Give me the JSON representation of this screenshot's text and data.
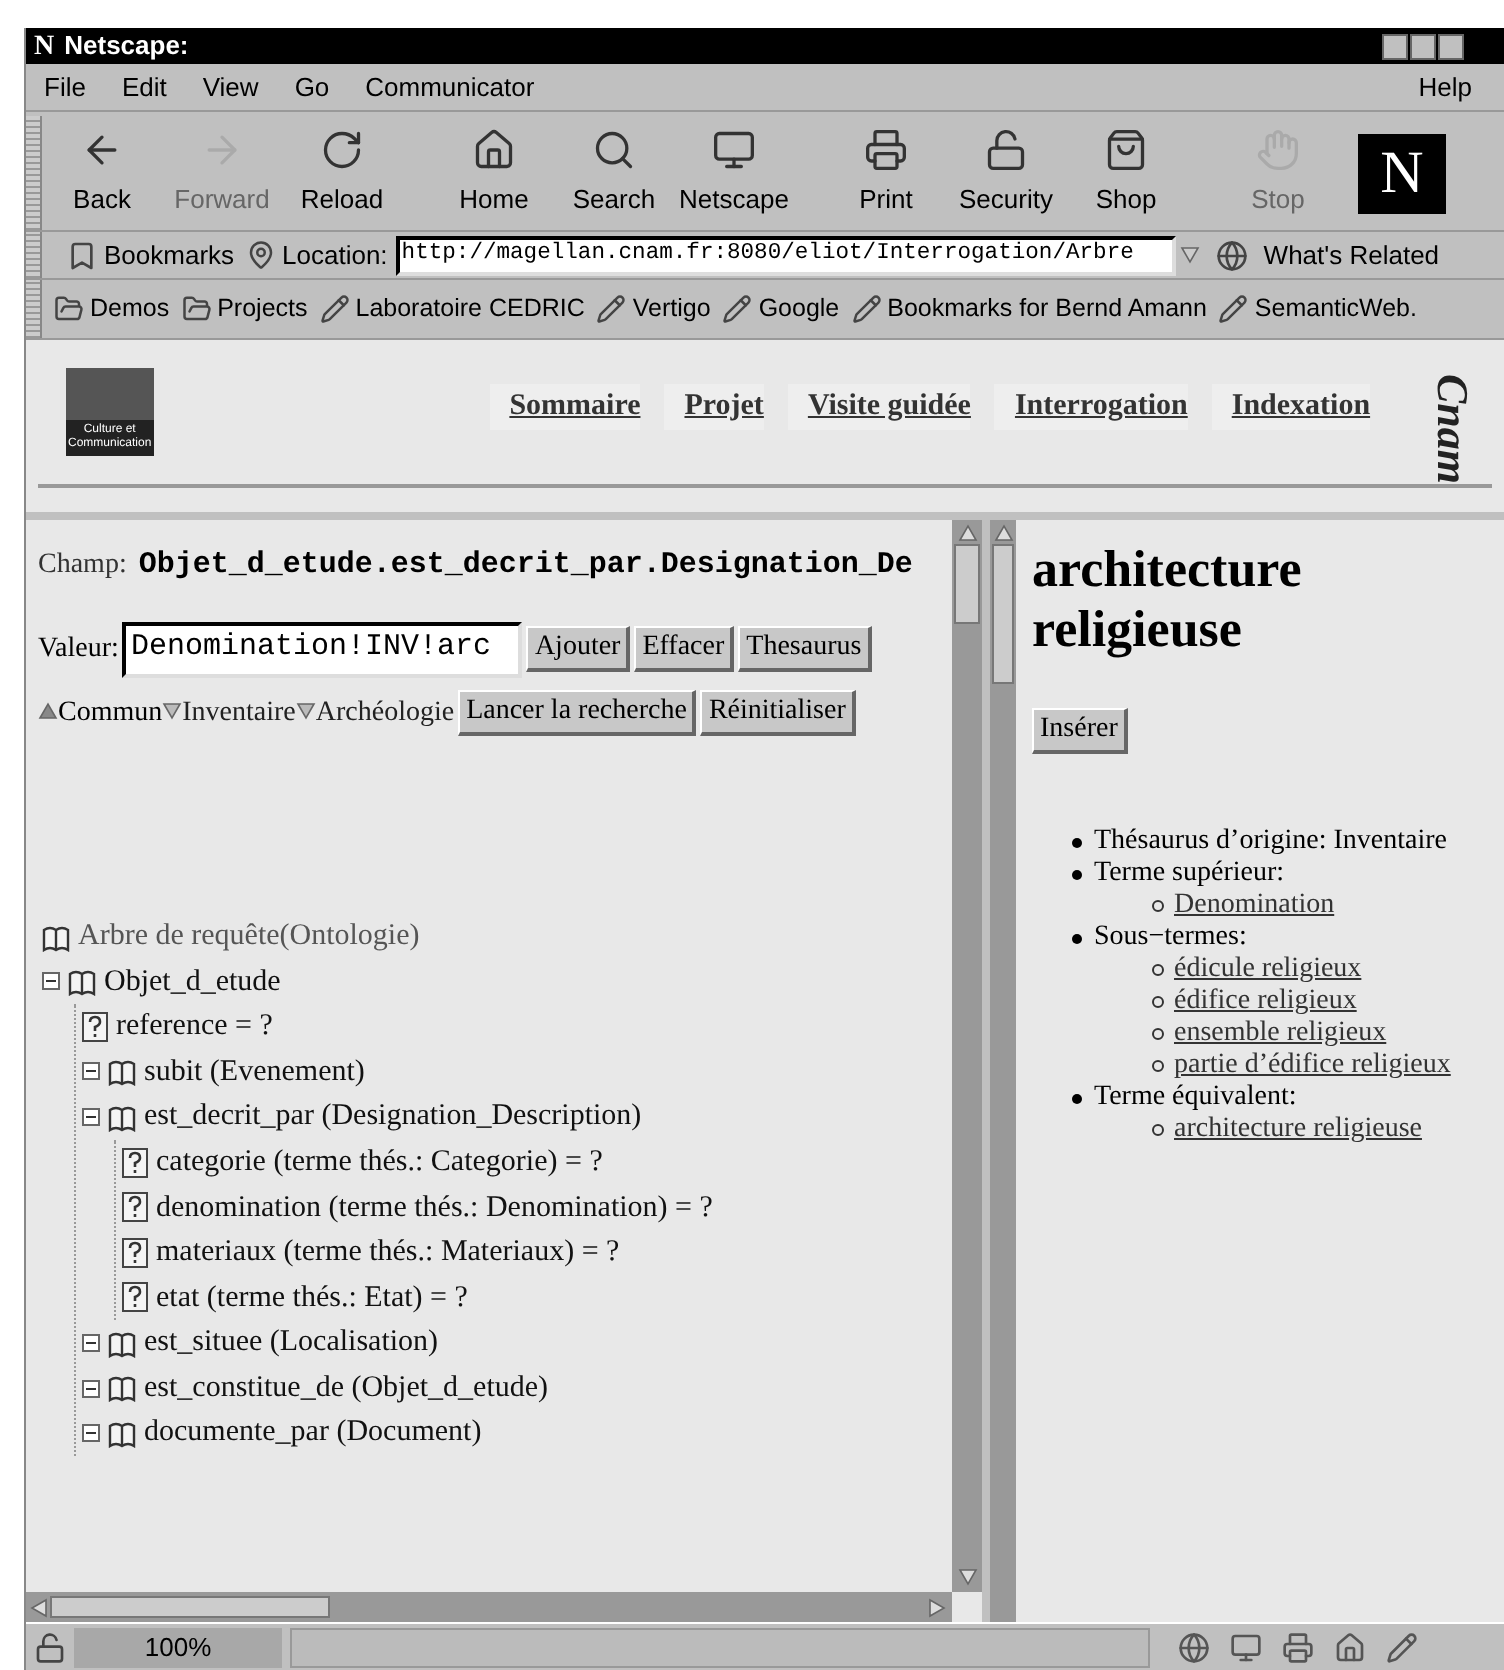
{
  "window": {
    "logo": "N",
    "title": "Netscape:"
  },
  "menu": {
    "items": [
      "File",
      "Edit",
      "View",
      "Go",
      "Communicator"
    ],
    "help": "Help"
  },
  "toolbar": {
    "buttons": [
      {
        "label": "Back",
        "disabled": false
      },
      {
        "label": "Forward",
        "disabled": true
      },
      {
        "label": "Reload",
        "disabled": false
      },
      {
        "label": "Home",
        "disabled": false
      },
      {
        "label": "Search",
        "disabled": false
      },
      {
        "label": "Netscape",
        "disabled": false
      },
      {
        "label": "Print",
        "disabled": false
      },
      {
        "label": "Security",
        "disabled": false
      },
      {
        "label": "Shop",
        "disabled": false
      },
      {
        "label": "Stop",
        "disabled": true
      }
    ],
    "throbber": "N"
  },
  "location_bar": {
    "bookmarks": "Bookmarks",
    "label": "Location:",
    "url": "http://magellan.cnam.fr:8080/eliot/Interrogation/Arbre",
    "related": "What's Related"
  },
  "personal_toolbar": [
    {
      "label": "Demos",
      "kind": "folder"
    },
    {
      "label": "Projects",
      "kind": "folder"
    },
    {
      "label": "Laboratoire CEDRIC",
      "kind": "link"
    },
    {
      "label": "Vertigo",
      "kind": "link"
    },
    {
      "label": "Google",
      "kind": "link"
    },
    {
      "label": "Bookmarks for Bernd Amann",
      "kind": "link"
    },
    {
      "label": "SemanticWeb.",
      "kind": "link"
    }
  ],
  "banner": {
    "ministry_logo": "Culture et Communication",
    "nav": [
      "Sommaire",
      "Projet",
      "Visite guidée",
      "Interrogation",
      "Indexation"
    ],
    "cnam_logo": "Cnam"
  },
  "query": {
    "champ_label": "Champ:",
    "champ": "Objet_d_etude.est_decrit_par.Designation_De",
    "valeur_label": "Valeur:",
    "valeur": "Denomination!INV!arc",
    "buttons": [
      "Ajouter",
      "Effacer",
      "Thesaurus"
    ],
    "thesauri": [
      {
        "label": "Commun",
        "selected": true
      },
      {
        "label": "Inventaire",
        "selected": false
      },
      {
        "label": "Archéologie",
        "selected": false
      }
    ],
    "actions": [
      "Lancer la recherche",
      "Réinitialiser"
    ]
  },
  "tree": {
    "label": "Arbre de requête(Ontologie)",
    "children": [
      {
        "label": "Objet_d_etude",
        "kind": "class",
        "expanded": true,
        "children": [
          {
            "label": "reference = ?",
            "kind": "field"
          },
          {
            "label": "subit (Evenement)",
            "kind": "class",
            "expanded": true
          },
          {
            "label": "est_decrit_par (Designation_Description)",
            "kind": "class",
            "expanded": true,
            "children": [
              {
                "label": "categorie (terme thés.: Categorie) = ?",
                "kind": "field"
              },
              {
                "label": "denomination (terme thés.: Denomination) = ?",
                "kind": "field"
              },
              {
                "label": "materiaux (terme thés.: Materiaux) = ?",
                "kind": "field"
              },
              {
                "label": "etat (terme thés.: Etat) = ?",
                "kind": "field"
              }
            ]
          },
          {
            "label": "est_situee (Localisation)",
            "kind": "class",
            "expanded": true
          },
          {
            "label": "est_constitue_de (Objet_d_etude)",
            "kind": "class",
            "expanded": true
          },
          {
            "label": "documente_par (Document)",
            "kind": "class",
            "expanded": true
          }
        ]
      }
    ]
  },
  "term": {
    "title": "architecture religieuse",
    "button": "Insérer",
    "items": [
      {
        "text": "Thésaurus d’origine: Inventaire"
      },
      {
        "text": "Terme supérieur:",
        "children": [
          "Denomination"
        ]
      },
      {
        "text": "Sous−termes:",
        "children": [
          "édicule religieux",
          "édifice religieux",
          "ensemble religieux",
          "partie d’édifice religieux"
        ]
      },
      {
        "text": "Terme équivalent:",
        "children": [
          "architecture religieuse"
        ]
      }
    ]
  },
  "status_bar": {
    "zoom": "100%"
  }
}
